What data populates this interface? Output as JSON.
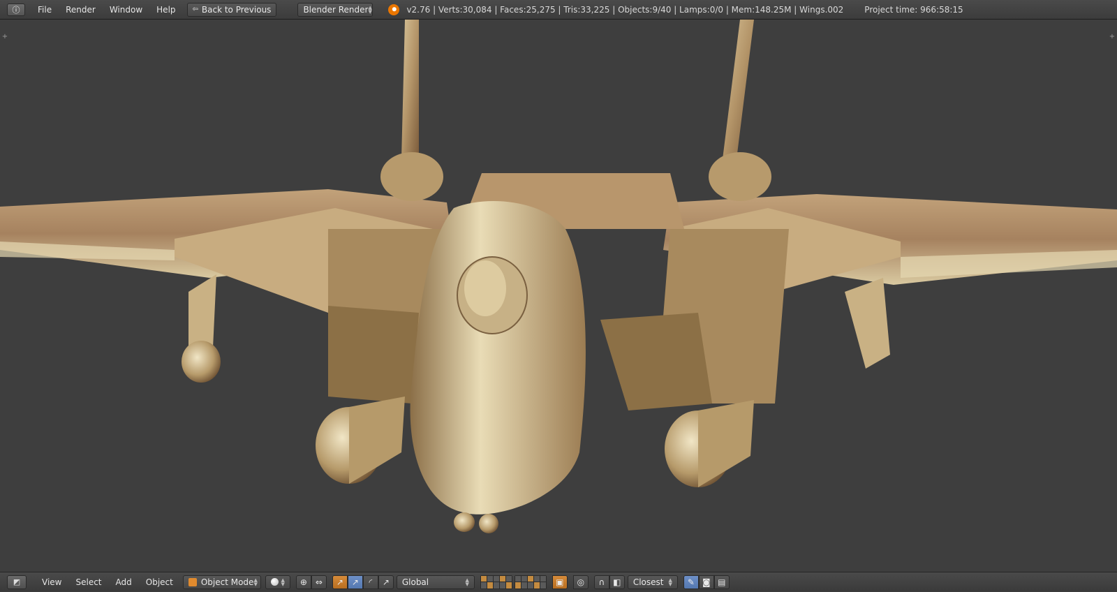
{
  "topbar": {
    "editor_type_icon": "info-icon",
    "menus": [
      "File",
      "Render",
      "Window",
      "Help"
    ],
    "back_button": "Back to Previous",
    "render_engine": "Blender Render",
    "stats": "v2.76 | Verts:30,084 | Faces:25,275 | Tris:33,225 | Objects:9/40 | Lamps:0/0 | Mem:148.25M | Wings.002",
    "project_time": "Project time: 966:58:15"
  },
  "viewport": {
    "background_color": "#3e3e3e",
    "model_color": "#b8a178",
    "corner_glyph": "+"
  },
  "bottombar": {
    "editor_type_icon": "3d-view-icon",
    "menus": [
      "View",
      "Select",
      "Add",
      "Object"
    ],
    "mode": "Object Mode",
    "viewport_shading_icon": "solid-shading-icon",
    "pivot_icon": "pivot-point-icon",
    "transform_orientation": "Global",
    "snap_target": "Closest"
  }
}
